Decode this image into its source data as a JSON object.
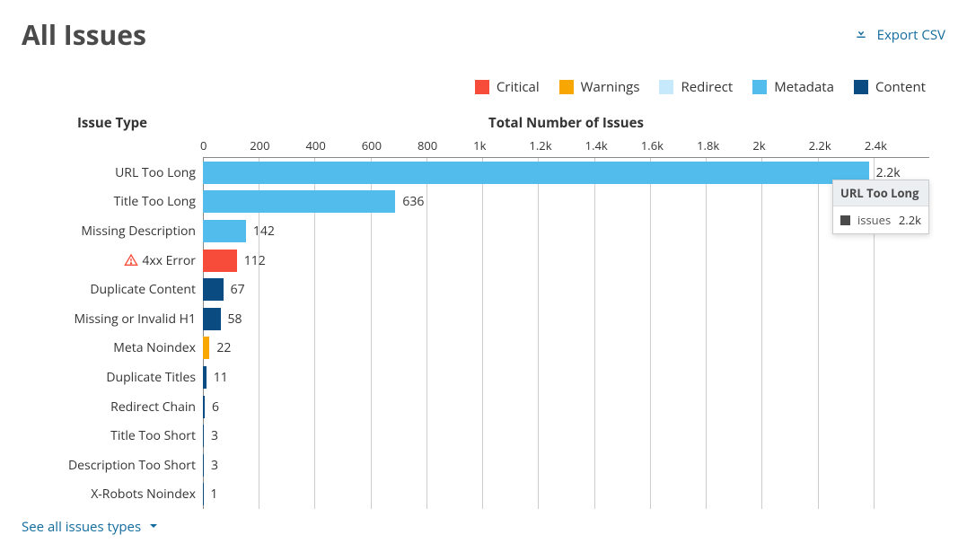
{
  "header": {
    "title": "All Issues",
    "export_label": "Export CSV"
  },
  "legend": [
    {
      "label": "Critical",
      "color": "#f84c3b"
    },
    {
      "label": "Warnings",
      "color": "#f7a602"
    },
    {
      "label": "Redirect",
      "color": "#c6e9fb"
    },
    {
      "label": "Metadata",
      "color": "#52bdec"
    },
    {
      "label": "Content",
      "color": "#0a4c82"
    }
  ],
  "axis": {
    "y_title": "Issue Type",
    "x_title": "Total Number of Issues",
    "ticks": [
      "0",
      "200",
      "400",
      "600",
      "800",
      "1k",
      "1.2k",
      "1.4k",
      "1.6k",
      "1.8k",
      "2k",
      "2.2k",
      "2.4k"
    ]
  },
  "tooltip": {
    "title": "URL Too Long",
    "series_label": "issues",
    "value_label": "2.2k"
  },
  "footer": {
    "see_all": "See all issues types"
  },
  "chart_data": {
    "type": "bar",
    "orientation": "horizontal",
    "xlabel": "Total Number of Issues",
    "ylabel": "Issue Type",
    "xlim": [
      0,
      2400
    ],
    "legend_position": "top-right",
    "categories": [
      "URL Too Long",
      "Title Too Long",
      "Missing Description",
      "4xx Error",
      "Duplicate Content",
      "Missing or Invalid H1",
      "Meta Noindex",
      "Duplicate Titles",
      "Redirect Chain",
      "Title Too Short",
      "Description Too Short",
      "X-Robots Noindex"
    ],
    "values": [
      2200,
      636,
      142,
      112,
      67,
      58,
      22,
      11,
      6,
      3,
      3,
      1
    ],
    "value_labels": [
      "2.2k",
      "636",
      "142",
      "112",
      "67",
      "58",
      "22",
      "11",
      "6",
      "3",
      "3",
      "1"
    ],
    "series_group": [
      "Metadata",
      "Metadata",
      "Metadata",
      "Critical",
      "Content",
      "Content",
      "Warnings",
      "Content",
      "Content",
      "Content",
      "Content",
      "Content"
    ],
    "colors": [
      "#52bdec",
      "#52bdec",
      "#52bdec",
      "#f84c3b",
      "#0a4c82",
      "#0a4c82",
      "#f7a602",
      "#0a4c82",
      "#0a4c82",
      "#0a4c82",
      "#0a4c82",
      "#0a4c82"
    ],
    "row_has_warning_icon": [
      false,
      false,
      false,
      true,
      false,
      false,
      false,
      false,
      false,
      false,
      false,
      false
    ]
  }
}
